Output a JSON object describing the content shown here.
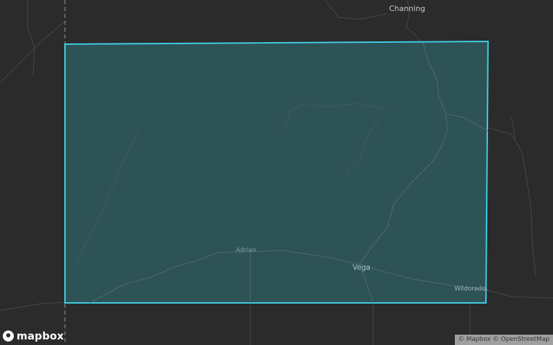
{
  "map": {
    "colors": {
      "background": "#2b2b2b",
      "road": "#3f4543",
      "road_major": "#4a5350",
      "county_fill": "#2f5a5e",
      "county_outline": "#3fd0e8",
      "label": "#c9c9c9",
      "label_inner": "#7fa4a6"
    },
    "places": {
      "channing": "Channing",
      "adrian": "Adrian",
      "vega": "Vega",
      "wildorado": "Wildorado"
    }
  },
  "branding": {
    "logo_text": "mapbox",
    "logo_icon": "mapbox-logo-icon"
  },
  "attribution": {
    "mapbox": "© Mapbox",
    "osm": "© OpenStreetMap"
  }
}
